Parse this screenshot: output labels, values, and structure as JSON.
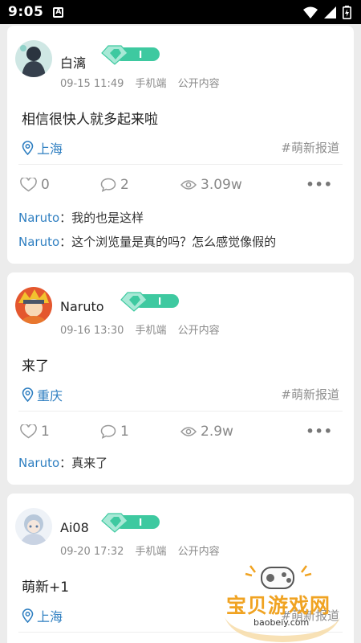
{
  "status_bar": {
    "time": "9:05",
    "notification_glyph": "A"
  },
  "posts": [
    {
      "username": "白漓",
      "date": "09-15 11:49",
      "device": "手机端",
      "visibility": "公开内容",
      "content": "相信很快人就多起来啦",
      "location": "上海",
      "tag": "#萌新报道",
      "likes": "0",
      "comments_count": "2",
      "views": "3.09w",
      "comments": [
        {
          "name": "Naruto",
          "sep": "：",
          "text": "我的也是这样"
        },
        {
          "name": "Naruto",
          "sep": "：",
          "text": "这个浏览量是真的吗？怎么感觉像假的"
        }
      ]
    },
    {
      "username": "Naruto",
      "date": "09-16 13:30",
      "device": "手机端",
      "visibility": "公开内容",
      "content": "来了",
      "location": "重庆",
      "tag": "#萌新报道",
      "likes": "1",
      "comments_count": "1",
      "views": "2.9w",
      "comments": [
        {
          "name": "Naruto",
          "sep": "：",
          "text": "真来了"
        }
      ]
    },
    {
      "username": "Ai08",
      "date": "09-20 17:32",
      "device": "手机端",
      "visibility": "公开内容",
      "content": "萌新+1",
      "location": "上海",
      "tag": "#萌新报道"
    }
  ],
  "watermark": {
    "title": "宝贝游戏网",
    "url": "baobeiy.com"
  },
  "colors": {
    "link": "#2f7fc1",
    "badge_green": "#3ec9a0",
    "watermark": "#f0a322"
  }
}
